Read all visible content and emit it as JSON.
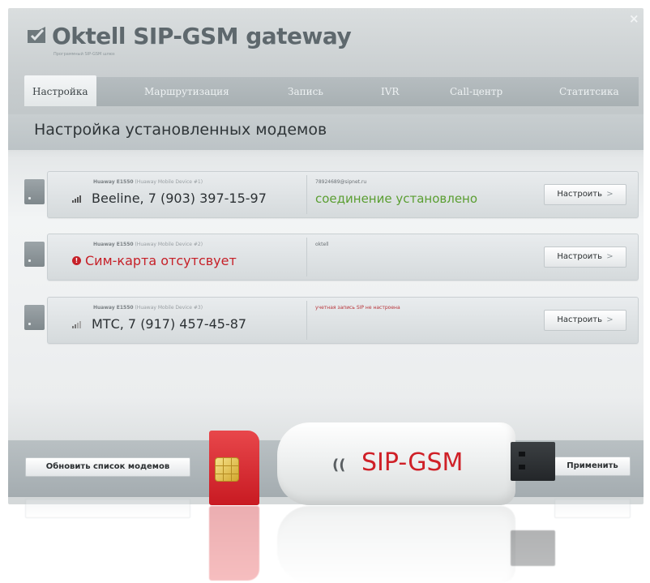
{
  "window": {
    "title": "Oktell SIP-GSM gateway",
    "subtitle": "Программный SIP-GSM шлюз",
    "close_icon": "×"
  },
  "tabs": [
    {
      "label": "Настройка",
      "active": true
    },
    {
      "label": "Маршрутизация",
      "active": false
    },
    {
      "label": "Запись",
      "active": false
    },
    {
      "label": "IVR",
      "active": false
    },
    {
      "label": "Call-центр",
      "active": false
    },
    {
      "label": "Статитсика",
      "active": false
    }
  ],
  "page_title": "Настройка установленных модемов",
  "modems": [
    {
      "device": "Huaway E1550",
      "device_detail": "(Huaway Mobile Device #1)",
      "info": "Beeline, 7 (903) 397-15-97",
      "icon": "signal-icon",
      "sip": "78924689@sipnet.ru",
      "status": "соединение установлено",
      "error": false,
      "button": "Настроить"
    },
    {
      "device": "Huaway E1550",
      "device_detail": "(Huaway Mobile Device #2)",
      "info": "Сим-карта отсутсвует",
      "icon": "error-icon",
      "sip": "oktell",
      "status": "",
      "error": true,
      "button": "Настроить"
    },
    {
      "device": "Huaway E1550",
      "device_detail": "(Huaway Mobile Device #3)",
      "info": "МТС, 7 (917) 457-45-87",
      "icon": "signal-icon",
      "sip": "учетная запись SIP не настроена",
      "status": "",
      "error": false,
      "button": "Настроить"
    }
  ],
  "buttons": {
    "refresh": "Обновить список модемов",
    "apply": "Применить",
    "chevron": ">"
  },
  "usb": {
    "label": "SIP-GSM",
    "wave": "(("
  },
  "colors": {
    "status_ok": "#5a9e31",
    "error": "#c62028",
    "sim_red": "#c81a22"
  }
}
